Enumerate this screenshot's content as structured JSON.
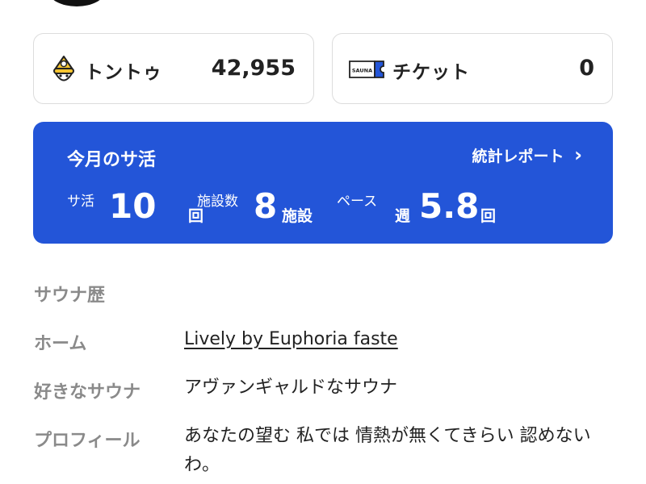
{
  "balances": {
    "tonttu": {
      "label": "トントゥ",
      "value": "42,955",
      "icon": "tonttu-mascot-icon"
    },
    "ticket": {
      "label": "チケット",
      "value": "0",
      "icon": "sauna-ticket-icon",
      "icon_text": "SAUNA"
    }
  },
  "monthly": {
    "title": "今月のサ活",
    "report_link": "統計レポート",
    "report_arrow": "›",
    "metrics": {
      "sessions": {
        "label": "サ活",
        "value": "10",
        "unit": "回"
      },
      "facilities": {
        "label": "施設数",
        "value": "8",
        "unit": "施設"
      },
      "pace": {
        "label": "ペース",
        "prefix": "週",
        "value": "5.8",
        "unit": "回"
      }
    }
  },
  "profile": {
    "history_label": "サウナ歴",
    "home_label": "ホーム",
    "home_value": "Lively by Euphoria faste",
    "favorite_label": "好きなサウナ",
    "favorite_value": "アヴァンギャルドなサウナ",
    "bio_label": "プロフィール",
    "bio_value": "あなたの望む 私では 情熱が無くてきらい 認めないわ。"
  },
  "colors": {
    "accent": "#2355d8",
    "muted": "#8a8a8a",
    "border": "#dcdcdc"
  }
}
